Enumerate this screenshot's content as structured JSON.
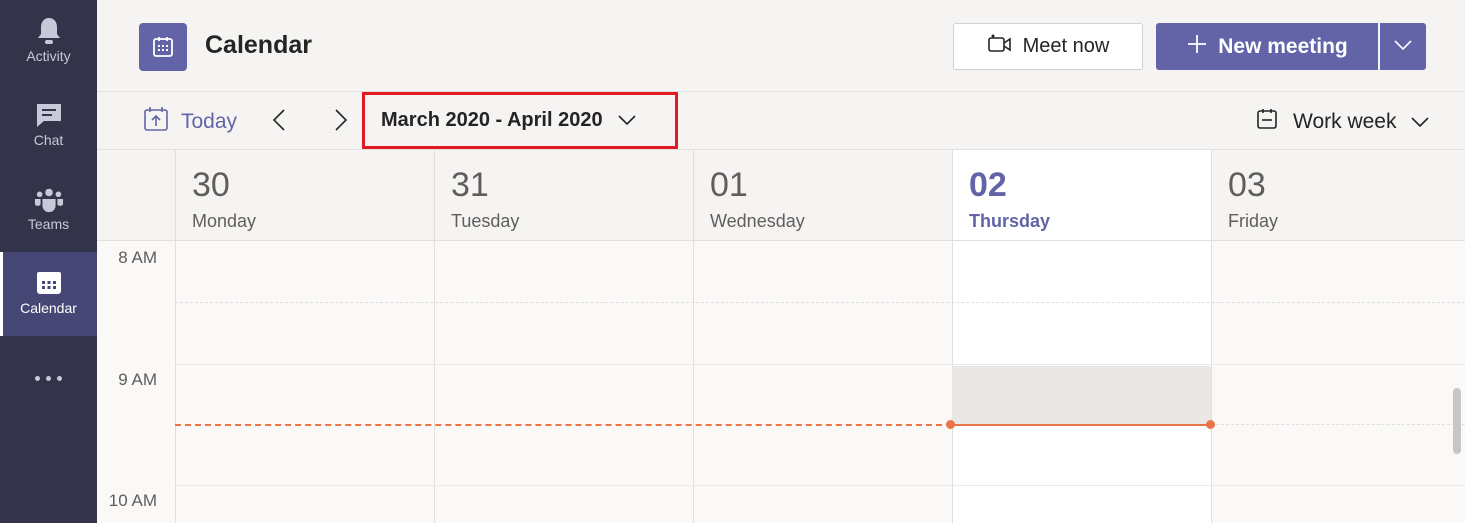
{
  "rail": {
    "items": [
      {
        "label": "Activity",
        "icon": "bell-icon"
      },
      {
        "label": "Chat",
        "icon": "chat-icon"
      },
      {
        "label": "Teams",
        "icon": "teams-icon"
      },
      {
        "label": "Calendar",
        "icon": "calendar-icon",
        "active": true
      }
    ],
    "more_icon": "more-icon"
  },
  "header": {
    "title": "Calendar",
    "meet_now_label": "Meet now",
    "new_meeting_label": "New meeting"
  },
  "toolbar": {
    "today_label": "Today",
    "date_range": "March 2020 - April 2020",
    "view_label": "Work week"
  },
  "days": [
    {
      "num": "30",
      "name": "Monday"
    },
    {
      "num": "31",
      "name": "Tuesday"
    },
    {
      "num": "01",
      "name": "Wednesday"
    },
    {
      "num": "02",
      "name": "Thursday",
      "today": true
    },
    {
      "num": "03",
      "name": "Friday"
    }
  ],
  "times": [
    "8 AM",
    "9 AM",
    "10 AM"
  ],
  "colors": {
    "brand": "#6264a7",
    "rail": "#33344a",
    "now_line": "#e97548",
    "highlight_border": "#e21b23"
  }
}
